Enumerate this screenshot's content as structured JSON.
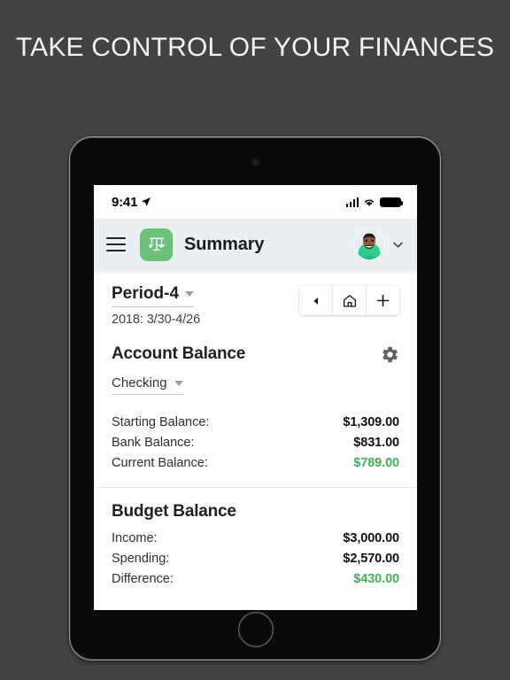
{
  "headline": "TAKE CONTROL OF YOUR FINANCES",
  "device": {
    "camera_icon": "camera-dot",
    "home_button_icon": "home-button-circle"
  },
  "status_bar": {
    "time": "9:41",
    "location_icon": "location-arrow-icon",
    "signal_icon": "cellular-signal-icon",
    "wifi_icon": "wifi-icon",
    "battery_icon": "battery-full-icon"
  },
  "app_bar": {
    "menu_icon": "hamburger-menu-icon",
    "app_icon": "balance-scales-icon",
    "title": "Summary",
    "avatar_icon": "user-avatar",
    "chevron_icon": "chevron-down-icon"
  },
  "period": {
    "label": "Period-4",
    "caret_icon": "caret-down-icon",
    "dates": "2018: 3/30-4/26",
    "buttons": [
      {
        "name": "previous-period-button",
        "icon": "triangle-left-icon"
      },
      {
        "name": "home-period-button",
        "icon": "house-icon"
      },
      {
        "name": "add-period-button",
        "icon": "plus-icon"
      }
    ]
  },
  "account_balance": {
    "title": "Account Balance",
    "settings_icon": "gear-icon",
    "account": "Checking",
    "account_caret_icon": "caret-down-icon",
    "rows": [
      {
        "label": "Starting Balance:",
        "value": "$1,309.00",
        "green": false
      },
      {
        "label": "Bank Balance:",
        "value": "$831.00",
        "green": false
      },
      {
        "label": "Current Balance:",
        "value": "$789.00",
        "green": true
      }
    ]
  },
  "budget_balance": {
    "title": "Budget Balance",
    "rows": [
      {
        "label": "Income:",
        "value": "$3,000.00",
        "green": false
      },
      {
        "label": "Spending:",
        "value": "$2,570.00",
        "green": false
      },
      {
        "label": "Difference:",
        "value": "$430.00",
        "green": true
      }
    ]
  },
  "colors": {
    "background": "#434343",
    "accent_green": "#43b05c",
    "app_icon_green": "#6bc07a",
    "app_bar": "#eceff1"
  }
}
